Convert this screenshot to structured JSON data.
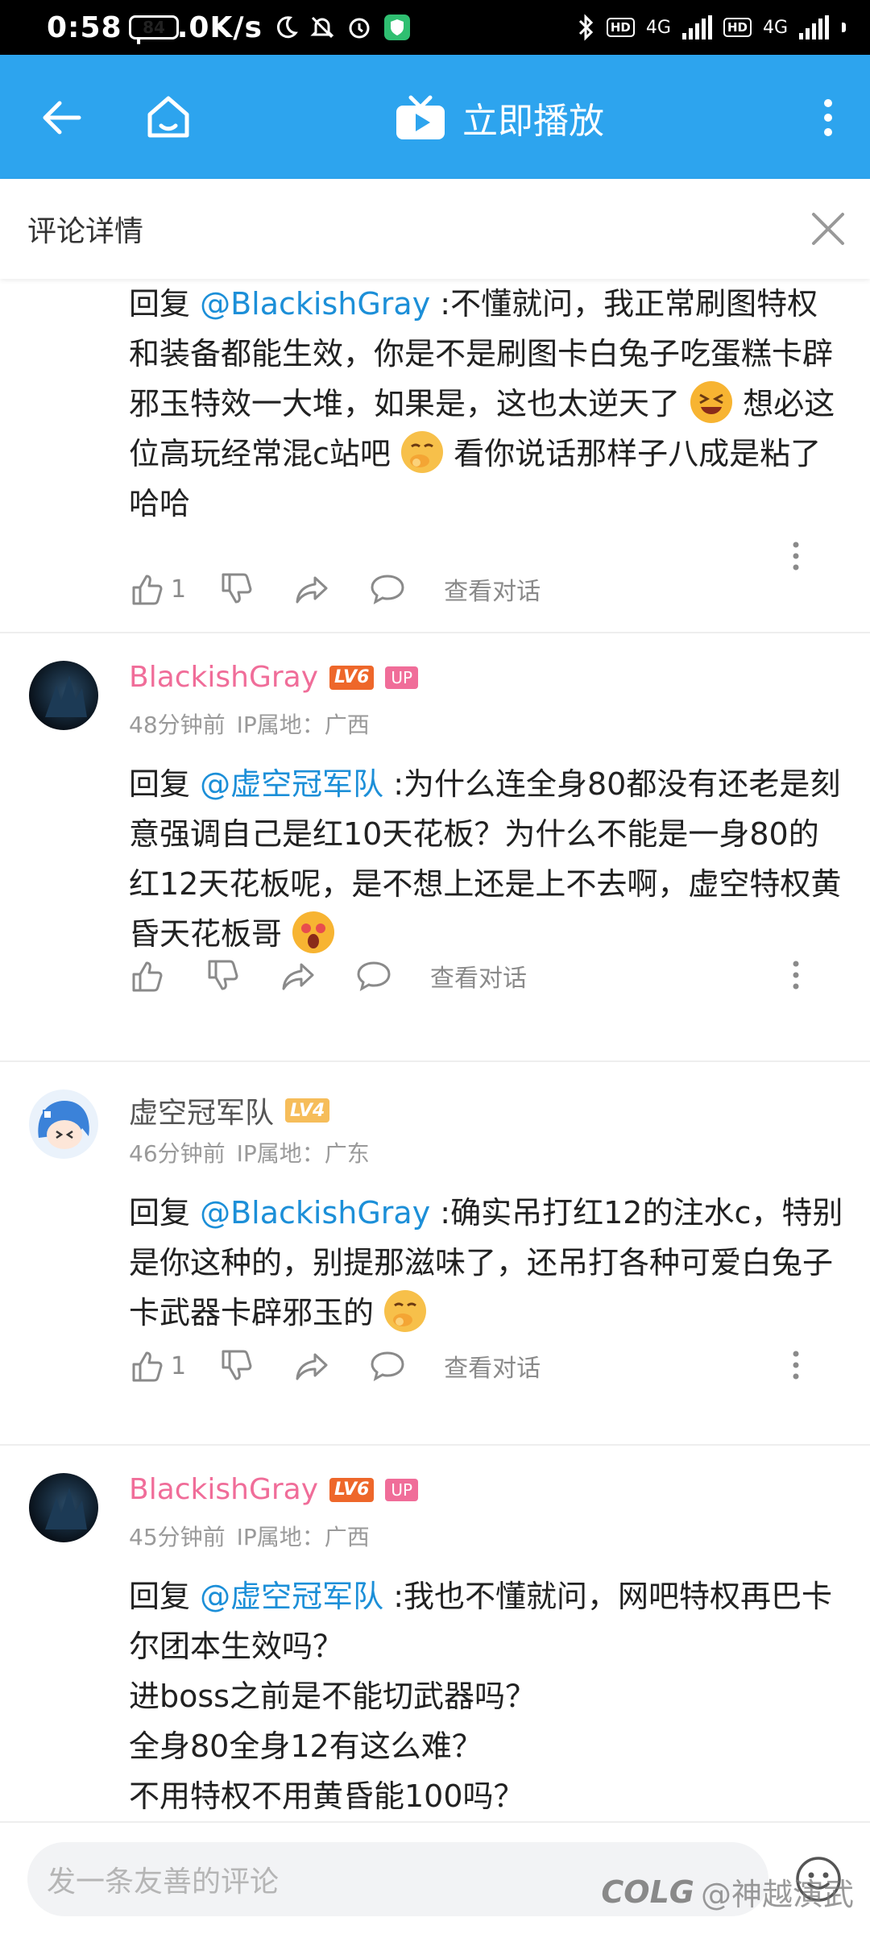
{
  "status": {
    "time": "0:58",
    "speed": "0.0K/s",
    "net1": "4G",
    "net2": "4G",
    "hd": "HD",
    "battery": "84"
  },
  "appbar": {
    "play_label": "立即播放"
  },
  "subheader": {
    "title": "评论详情"
  },
  "comments": [
    {
      "reply_prefix": "回复",
      "mention": "@BlackishGray",
      "text_a": " :不懂就问，我正常刷图特权和装备都能生效，你是不是刷图卡白兔子吃蛋糕卡辟邪玉特效一大堆，如果是，这也太逆天了",
      "text_b": "想必这位高玩经常混c站吧",
      "text_c": "看你说话那样子八成是粘了哈哈",
      "like_count": "1",
      "view_dialog": "查看对话"
    },
    {
      "name": "BlackishGray",
      "level": "LV6",
      "up_badge": "UP",
      "time": "48分钟前",
      "ip": "IP属地：广西",
      "reply_prefix": "回复",
      "mention": "@虚空冠军队",
      "text_a": " :为什么连全身80都没有还老是刻意强调自己是红10天花板？为什么不能是一身80的红12天花板呢，是不想上还是上不去啊，虚空特权黄昏天花板哥",
      "view_dialog": "查看对话"
    },
    {
      "name": "虚空冠军队",
      "level": "LV4",
      "time": "46分钟前",
      "ip": "IP属地：广东",
      "reply_prefix": "回复",
      "mention": "@BlackishGray",
      "text_a": " :确实吊打红12的注水c，特别是你这种的，别提那滋味了，还吊打各种可爱白兔子卡武器卡辟邪玉的",
      "like_count": "1",
      "view_dialog": "查看对话"
    },
    {
      "name": "BlackishGray",
      "level": "LV6",
      "up_badge": "UP",
      "time": "45分钟前",
      "ip": "IP属地：广西",
      "reply_prefix": "回复",
      "mention": "@虚空冠军队",
      "text_a": " :我也不懂就问，网吧特权再巴卡尔团本生效吗？",
      "line2": "进boss之前是不能切武器吗？",
      "line3": "全身80全身12有这么难？",
      "line4": "不用特权不用黄昏能100吗？"
    }
  ],
  "bottom": {
    "placeholder": "发一条友善的评论"
  },
  "watermark": {
    "brand": "COLG",
    "handle": "@神越演武"
  },
  "colors": {
    "accent": "#2da4ee",
    "username_pink": "#f06d99",
    "mention_blue": "#1c8fd8"
  }
}
